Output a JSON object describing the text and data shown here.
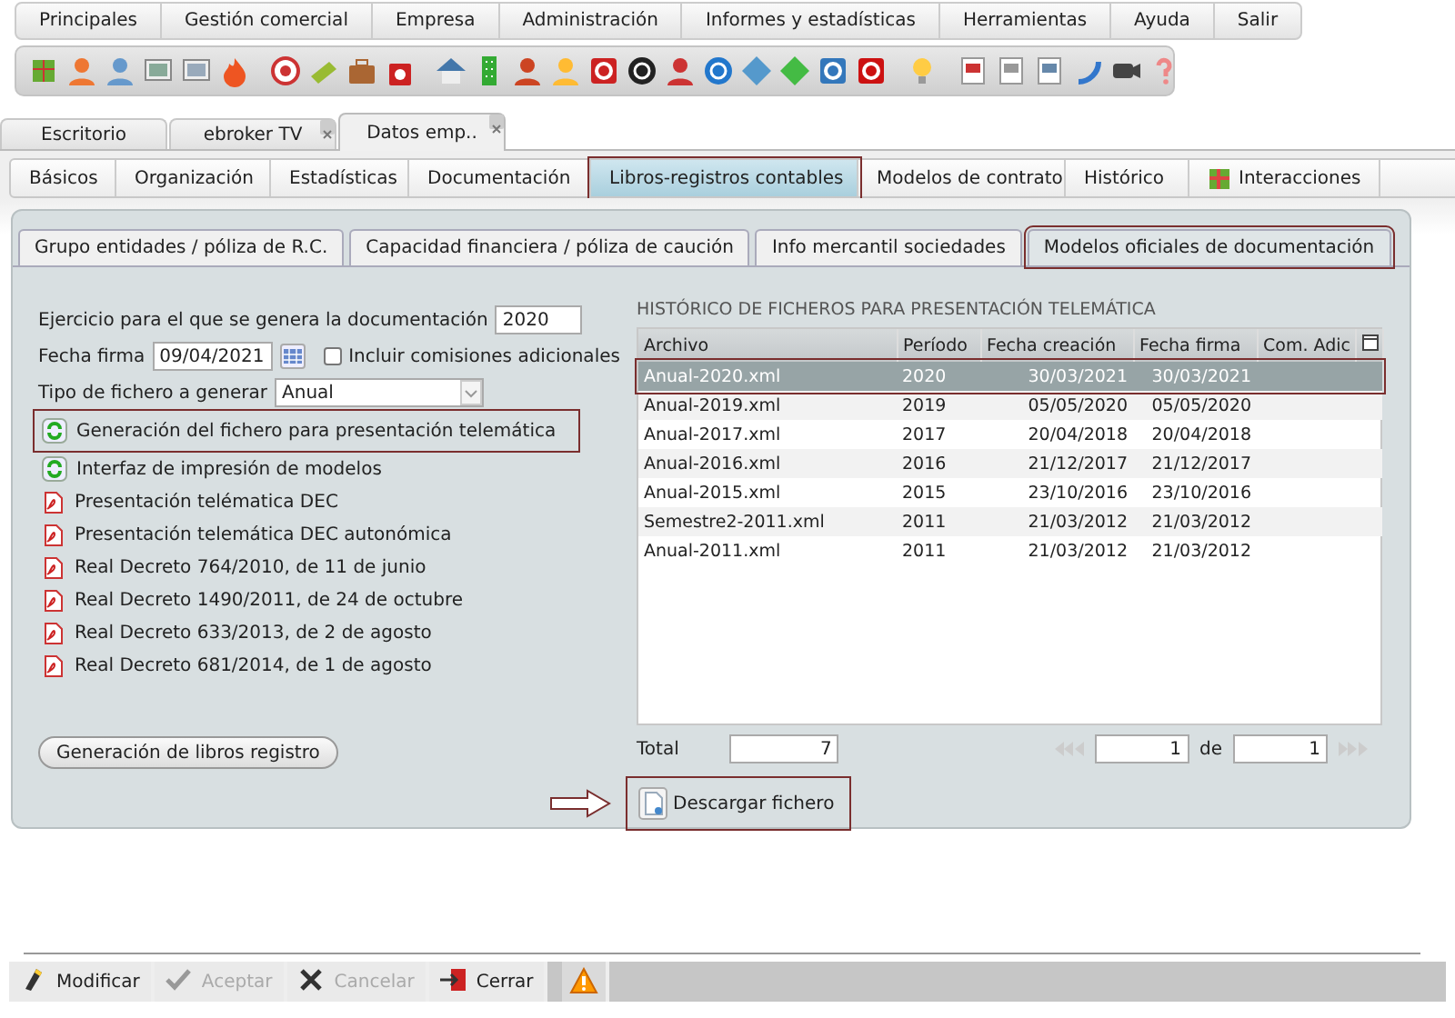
{
  "menu": [
    {
      "label": "Principales"
    },
    {
      "label": "Gestión comercial"
    },
    {
      "label": "Empresa"
    },
    {
      "label": "Administración"
    },
    {
      "label": "Informes y estadísticas"
    },
    {
      "label": "Herramientas"
    },
    {
      "label": "Ayuda"
    },
    {
      "label": "Salir"
    }
  ],
  "document_tabs": [
    {
      "label": "Escritorio",
      "selected": false,
      "closable": false
    },
    {
      "label": "ebroker TV",
      "selected": false,
      "closable": true
    },
    {
      "label": "Datos emp..",
      "selected": true,
      "closable": true
    }
  ],
  "section_tabs": [
    {
      "label": "Básicos",
      "selected": false,
      "highlighted": false,
      "kind": "text"
    },
    {
      "label": "Organización",
      "selected": false,
      "highlighted": false,
      "kind": "text"
    },
    {
      "label": "Estadísticas",
      "selected": false,
      "highlighted": false,
      "kind": "text"
    },
    {
      "label": "Documentación",
      "selected": false,
      "highlighted": false,
      "kind": "text"
    },
    {
      "label": "Libros-registros contables",
      "selected": true,
      "highlighted": true,
      "kind": "text"
    },
    {
      "label": "Modelos de contrato",
      "selected": false,
      "highlighted": false,
      "kind": "text"
    },
    {
      "label": "Histórico",
      "selected": false,
      "highlighted": false,
      "kind": "text"
    },
    {
      "label": "Interacciones",
      "selected": false,
      "highlighted": false,
      "kind": "icon"
    }
  ],
  "model_tabs": [
    {
      "label": "Grupo entidades / póliza de R.C.",
      "selected": false,
      "highlighted": false
    },
    {
      "label": "Capacidad financiera / póliza de caución",
      "selected": false,
      "highlighted": false
    },
    {
      "label": "Info mercantil sociedades",
      "selected": false,
      "highlighted": false
    },
    {
      "label": "Modelos oficiales de documentación",
      "selected": true,
      "highlighted": true
    }
  ],
  "form": {
    "year_label": "Ejercicio para el que se genera la documentación",
    "year_value": "2020",
    "date_label": "Fecha firma",
    "date_value": "09/04/2021",
    "include_label": "Incluir comisiones adicionales",
    "include_checked": false,
    "type_label": "Tipo de fichero a generar",
    "type_value": "Anual"
  },
  "actions": [
    {
      "kind": "generate",
      "label": "Generación del fichero para presentación telemática",
      "highlighted": true
    },
    {
      "kind": "generate",
      "label": "Interfaz de impresión de modelos",
      "highlighted": false
    },
    {
      "kind": "pdf",
      "label": "Presentación telématica DEC",
      "highlighted": false
    },
    {
      "kind": "pdf",
      "label": "Presentación telemática DEC autonómica",
      "highlighted": false
    },
    {
      "kind": "pdf",
      "label": "Real Decreto 764/2010, de 11 de junio",
      "highlighted": false
    },
    {
      "kind": "pdf",
      "label": "Real Decreto 1490/2011, de 24 de octubre",
      "highlighted": false
    },
    {
      "kind": "pdf",
      "label": "Real Decreto 633/2013, de 2 de agosto",
      "highlighted": false
    },
    {
      "kind": "pdf",
      "label": "Real Decreto 681/2014, de 1 de agosto",
      "highlighted": false
    }
  ],
  "books_button": "Generación de libros registro",
  "history": {
    "title": "HISTÓRICO DE FICHEROS PARA PRESENTACIÓN TELEMÁTICA",
    "columns": [
      "Archivo",
      "Período",
      "Fecha creación",
      "Fecha firma",
      "Com. Adic"
    ],
    "rows": [
      {
        "cells": [
          "Anual-2020.xml",
          "2020",
          "30/03/2021",
          "30/03/2021"
        ],
        "selected": true,
        "highlighted": true
      },
      {
        "cells": [
          "Anual-2019.xml",
          "2019",
          "05/05/2020",
          "05/05/2020"
        ],
        "selected": false,
        "highlighted": false
      },
      {
        "cells": [
          "Anual-2017.xml",
          "2017",
          "20/04/2018",
          "20/04/2018"
        ],
        "selected": false,
        "highlighted": false
      },
      {
        "cells": [
          "Anual-2016.xml",
          "2016",
          "21/12/2017",
          "21/12/2017"
        ],
        "selected": false,
        "highlighted": false
      },
      {
        "cells": [
          "Anual-2015.xml",
          "2015",
          "23/10/2016",
          "23/10/2016"
        ],
        "selected": false,
        "highlighted": false
      },
      {
        "cells": [
          "Semestre2-2011.xml",
          "2011",
          "21/03/2012",
          "21/03/2012"
        ],
        "selected": false,
        "highlighted": false
      },
      {
        "cells": [
          "Anual-2011.xml",
          "2011",
          "21/03/2012",
          "21/03/2012"
        ],
        "selected": false,
        "highlighted": false
      }
    ],
    "total_label": "Total",
    "total_value": "7",
    "page_value": "1",
    "of_label": "de",
    "page_count": "1"
  },
  "download": {
    "label": "Descargar fichero",
    "highlighted": true,
    "arrow": true
  },
  "footer_buttons": [
    {
      "kind": "edit",
      "label": "Modificar",
      "disabled": false
    },
    {
      "kind": "accept",
      "label": "Aceptar",
      "disabled": true
    },
    {
      "kind": "cancel",
      "label": "Cancelar",
      "disabled": true
    },
    {
      "kind": "close",
      "label": "Cerrar",
      "disabled": false
    },
    {
      "kind": "warning"
    }
  ]
}
